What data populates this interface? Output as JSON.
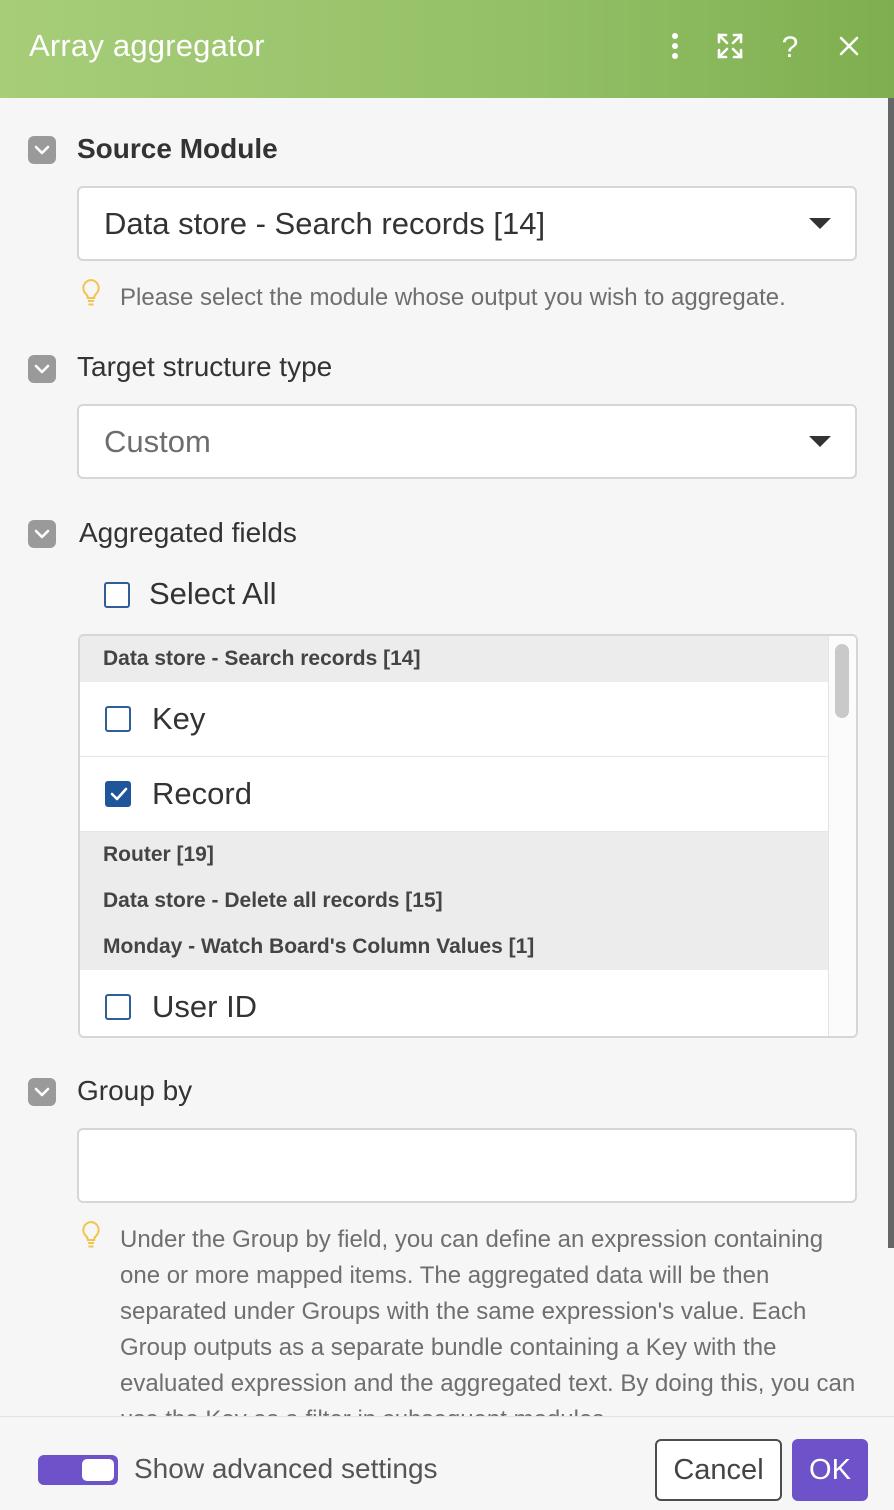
{
  "header": {
    "title": "Array aggregator"
  },
  "source_module": {
    "label": "Source Module",
    "value": "Data store - Search records [14]",
    "hint": "Please select the module whose output you wish to aggregate."
  },
  "target_structure": {
    "label": "Target structure type",
    "value": "Custom"
  },
  "aggregated_fields": {
    "label": "Aggregated fields",
    "select_all": "Select All",
    "groups": [
      {
        "title": "Data store - Search records [14]"
      },
      {
        "title": "Router [19]"
      },
      {
        "title": "Data store - Delete all records [15]"
      },
      {
        "title": "Monday - Watch Board's Column Values [1]"
      }
    ],
    "items": [
      {
        "label": "Key",
        "checked": false
      },
      {
        "label": "Record",
        "checked": true
      },
      {
        "label": "User ID",
        "checked": false
      }
    ]
  },
  "group_by": {
    "label": "Group by",
    "value": "",
    "hint": "Under the Group by field, you can define an expression containing one or more mapped items. The aggregated data will be then separated under Groups with the same expression's value. Each Group outputs as a separate bundle containing a Key with the evaluated expression and the aggregated text. By doing this, you can use the Key as a filter in subsequent modules."
  },
  "footer": {
    "advanced_label": "Show advanced settings",
    "advanced_on": true,
    "cancel_label": "Cancel",
    "ok_label": "OK"
  },
  "colors": {
    "header_green": "#93c067",
    "accent_purple": "#6d52c9",
    "checkbox_blue": "#1f5699"
  }
}
